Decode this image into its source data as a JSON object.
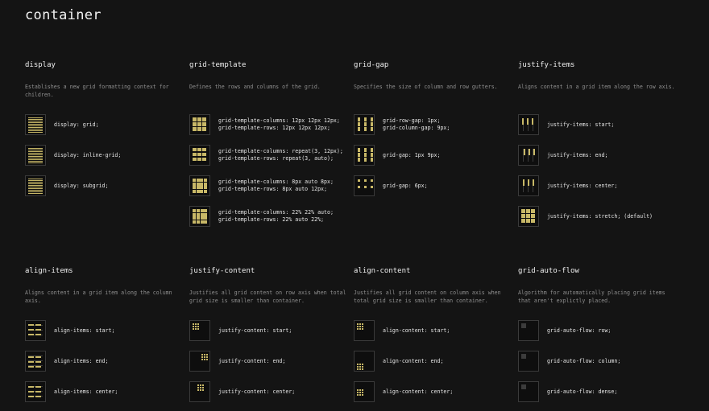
{
  "page": {
    "title": "container"
  },
  "sections": [
    {
      "id": "display",
      "title": "display",
      "desc": "Establishes a new grid formatting context for children.",
      "items": [
        {
          "code": [
            "display: grid;"
          ]
        },
        {
          "code": [
            "display: inline-grid;"
          ]
        },
        {
          "code": [
            "display: subgrid;"
          ]
        }
      ]
    },
    {
      "id": "grid-template",
      "title": "grid-template",
      "desc": "Defines the rows and columns of the grid.",
      "items": [
        {
          "code": [
            "grid-template-columns: 12px 12px 12px;",
            "grid-template-rows: 12px 12px 12px;"
          ]
        },
        {
          "code": [
            "grid-template-columns: repeat(3, 12px);",
            "grid-template-rows: repeat(3, auto);"
          ]
        },
        {
          "code": [
            "grid-template-columns: 8px auto 8px;",
            "grid-template-rows: 8px auto 12px;"
          ]
        },
        {
          "code": [
            "grid-template-columns: 22% 22% auto;",
            "grid-template-rows: 22% auto 22%;"
          ]
        }
      ]
    },
    {
      "id": "grid-gap",
      "title": "grid-gap",
      "desc": "Specifies the size of column and row gutters.",
      "items": [
        {
          "code": [
            "grid-row-gap: 1px;",
            "grid-column-gap: 9px;"
          ]
        },
        {
          "code": [
            "grid-gap: 1px 9px;"
          ]
        },
        {
          "code": [
            "grid-gap: 6px;"
          ]
        }
      ]
    },
    {
      "id": "justify-items",
      "title": "justify-items",
      "desc": "Aligns content in a grid item along the row axis.",
      "items": [
        {
          "code": [
            "justify-items: start;"
          ]
        },
        {
          "code": [
            "justify-items: end;"
          ]
        },
        {
          "code": [
            "justify-items: center;"
          ]
        },
        {
          "code": [
            "justify-items: stretch; (default)"
          ]
        }
      ]
    },
    {
      "id": "align-items",
      "title": "align-items",
      "desc": "Aligns content in a grid item along the column axis.",
      "items": [
        {
          "code": [
            "align-items: start;"
          ]
        },
        {
          "code": [
            "align-items: end;"
          ]
        },
        {
          "code": [
            "align-items: center;"
          ]
        }
      ]
    },
    {
      "id": "justify-content",
      "title": "justify-content",
      "desc": "Justifies all grid content on row axis when total grid size is smaller than container.",
      "items": [
        {
          "code": [
            "justify-content: start;"
          ]
        },
        {
          "code": [
            "justify-content: end;"
          ]
        },
        {
          "code": [
            "justify-content: center;"
          ]
        }
      ]
    },
    {
      "id": "align-content",
      "title": "align-content",
      "desc": "Justifies all grid content on column axis when total grid size is smaller than container.",
      "items": [
        {
          "code": [
            "align-content: start;"
          ]
        },
        {
          "code": [
            "align-content: end;"
          ]
        },
        {
          "code": [
            "align-content: center;"
          ]
        }
      ]
    },
    {
      "id": "grid-auto-flow",
      "title": "grid-auto-flow",
      "desc": "Algorithm for automatically placing grid items that aren't explictly placed.",
      "items": [
        {
          "code": [
            "grid-auto-flow: row;"
          ]
        },
        {
          "code": [
            "grid-auto-flow: column;"
          ]
        },
        {
          "code": [
            "grid-auto-flow: dense;"
          ]
        }
      ]
    }
  ],
  "colors": {
    "background": "#141414",
    "accent": "#c8b867",
    "muted": "#3c3c3c"
  }
}
